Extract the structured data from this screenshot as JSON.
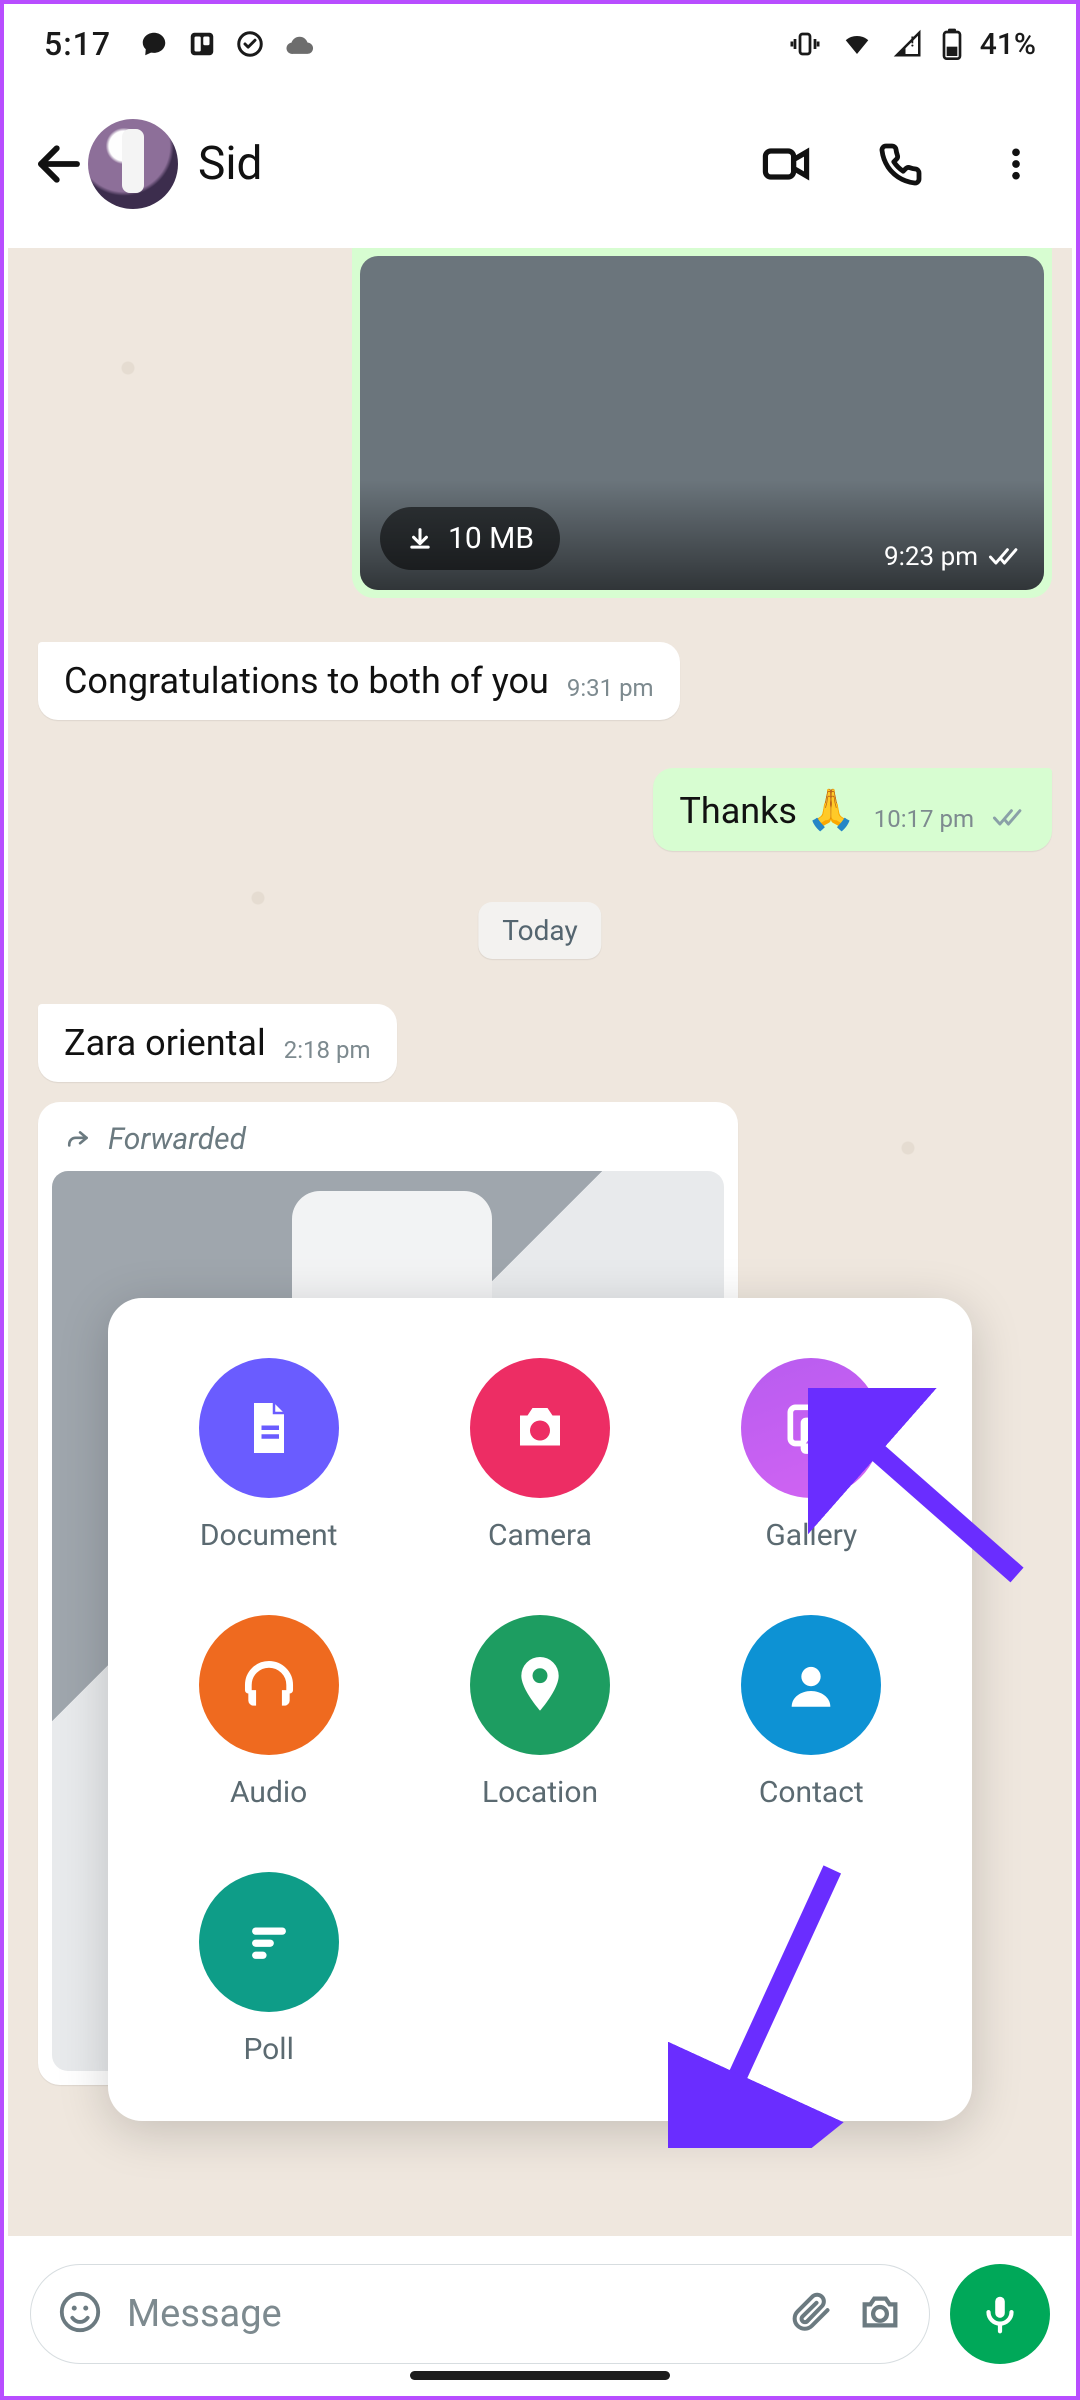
{
  "status": {
    "time": "5:17",
    "battery": "41%"
  },
  "header": {
    "contact_name": "Sid"
  },
  "media": {
    "size_label": "10 MB",
    "time": "9:23 pm"
  },
  "msg1": {
    "text": "Congratulations to both of you",
    "time": "9:31 pm"
  },
  "msg2": {
    "text": "Thanks",
    "emoji": "🙏",
    "time": "10:17 pm"
  },
  "date_chip": "Today",
  "msg3": {
    "text": "Zara oriental",
    "time": "2:18 pm"
  },
  "fwd": {
    "label": "Forwarded"
  },
  "attach": {
    "document": "Document",
    "camera": "Camera",
    "gallery": "Gallery",
    "audio": "Audio",
    "location": "Location",
    "contact": "Contact",
    "poll": "Poll"
  },
  "input": {
    "placeholder": "Message"
  }
}
